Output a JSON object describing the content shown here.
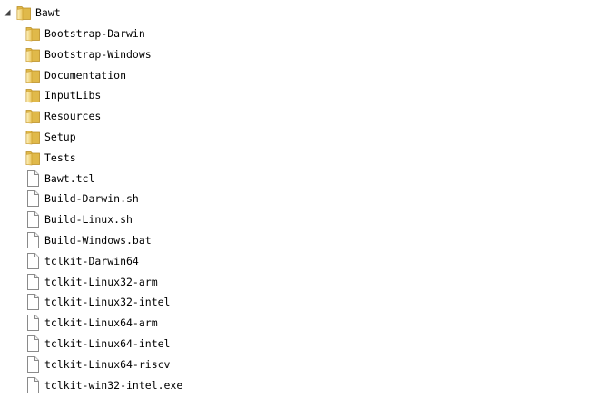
{
  "tree": {
    "root": {
      "label": "Bawt",
      "type": "folder",
      "expanded": true,
      "icon": "folder-icon",
      "toggle_icon": "expanded-triangle-icon"
    },
    "children": [
      {
        "label": "Bootstrap-Darwin",
        "type": "folder",
        "icon": "folder-icon"
      },
      {
        "label": "Bootstrap-Windows",
        "type": "folder",
        "icon": "folder-icon"
      },
      {
        "label": "Documentation",
        "type": "folder",
        "icon": "folder-icon"
      },
      {
        "label": "InputLibs",
        "type": "folder",
        "icon": "folder-icon"
      },
      {
        "label": "Resources",
        "type": "folder",
        "icon": "folder-icon"
      },
      {
        "label": "Setup",
        "type": "folder",
        "icon": "folder-icon"
      },
      {
        "label": "Tests",
        "type": "folder",
        "icon": "folder-icon"
      },
      {
        "label": "Bawt.tcl",
        "type": "file",
        "icon": "file-icon"
      },
      {
        "label": "Build-Darwin.sh",
        "type": "file",
        "icon": "file-icon"
      },
      {
        "label": "Build-Linux.sh",
        "type": "file",
        "icon": "file-icon"
      },
      {
        "label": "Build-Windows.bat",
        "type": "file",
        "icon": "file-icon"
      },
      {
        "label": "tclkit-Darwin64",
        "type": "file",
        "icon": "file-icon"
      },
      {
        "label": "tclkit-Linux32-arm",
        "type": "file",
        "icon": "file-icon"
      },
      {
        "label": "tclkit-Linux32-intel",
        "type": "file",
        "icon": "file-icon"
      },
      {
        "label": "tclkit-Linux64-arm",
        "type": "file",
        "icon": "file-icon"
      },
      {
        "label": "tclkit-Linux64-intel",
        "type": "file",
        "icon": "file-icon"
      },
      {
        "label": "tclkit-Linux64-riscv",
        "type": "file",
        "icon": "file-icon"
      },
      {
        "label": "tclkit-win32-intel.exe",
        "type": "file",
        "icon": "file-icon"
      }
    ]
  },
  "colors": {
    "folder_light": "#f7e7a3",
    "folder_dark": "#e0b94a",
    "folder_stroke": "#b98d22",
    "file_fill": "#ffffff",
    "file_stroke": "#8a8a8a",
    "text": "#000000",
    "background": "#ffffff"
  }
}
